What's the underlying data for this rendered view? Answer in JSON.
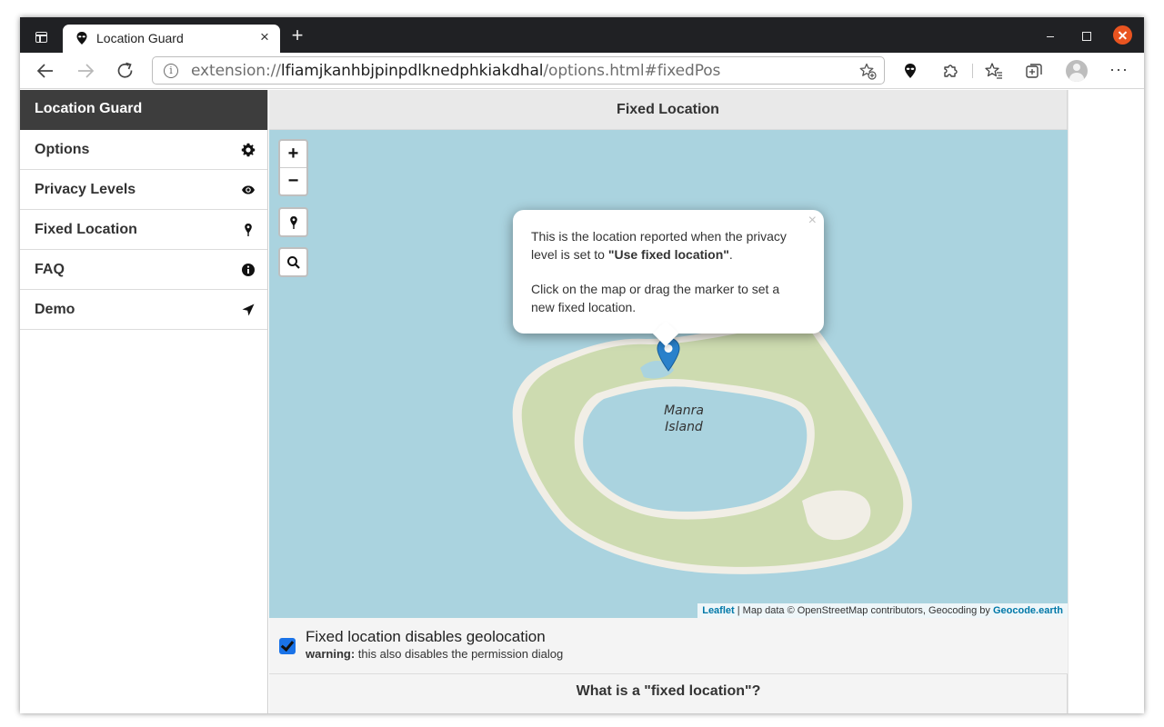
{
  "browser": {
    "tab_title": "Location Guard",
    "tab_close": "×",
    "new_tab": "+",
    "url_scheme": "extension://",
    "url_host": "lfiamjkanhbjpinpdlknedphkiakdhal",
    "url_path": "/options.html#fixedPos",
    "more": "···"
  },
  "sidebar": {
    "title": "Location Guard",
    "items": [
      {
        "label": "Options",
        "icon": "gear-icon"
      },
      {
        "label": "Privacy Levels",
        "icon": "eye-icon"
      },
      {
        "label": "Fixed Location",
        "icon": "map-pin-icon"
      },
      {
        "label": "FAQ",
        "icon": "info-icon"
      },
      {
        "label": "Demo",
        "icon": "location-arrow-icon"
      }
    ]
  },
  "main": {
    "title": "Fixed Location",
    "map": {
      "zoom_in": "+",
      "zoom_out": "−",
      "island_label_1": "Manra",
      "island_label_2": "Island",
      "popup_line1": "This is the location reported when the privacy level is set to ",
      "popup_bold": "\"Use fixed location\"",
      "popup_line1_end": ".",
      "popup_line2": "Click on the map or drag the marker to set a new fixed location.",
      "popup_close": "×",
      "attribution_leaflet": "Leaflet",
      "attribution_middle": " | Map data © OpenStreetMap contributors, Geocoding by ",
      "attribution_geocode": "Geocode.earth"
    },
    "checkbox": {
      "label": "Fixed location disables geolocation",
      "checked": true,
      "warning_bold": "warning:",
      "warning_text": " this also disables the permission dialog"
    },
    "faq_heading": "What is a \"fixed location\"?"
  },
  "colors": {
    "sidebar_header": "#3d3d3d",
    "map_water": "#aad3df",
    "island_land": "#cddbb0",
    "island_beach": "#f1eee6",
    "marker": "#2a81cb",
    "checkbox": "#1a73e8",
    "close_button": "#e95420"
  }
}
